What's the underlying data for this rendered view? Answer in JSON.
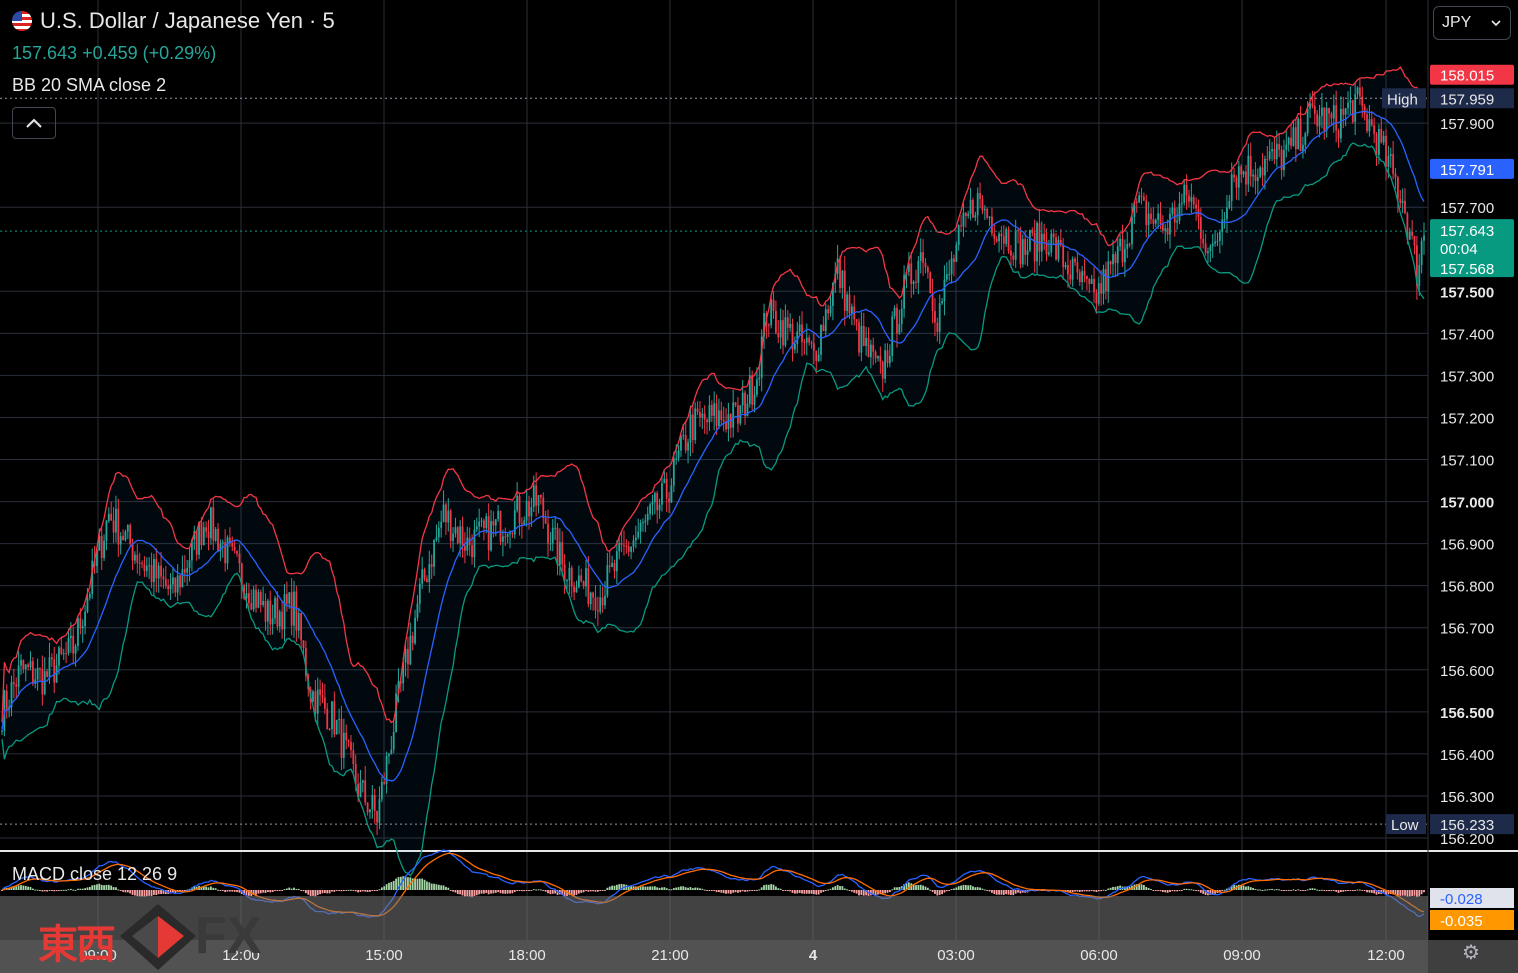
{
  "header": {
    "title": "U.S. Dollar / Japanese Yen · 5",
    "price": "157.643",
    "change": "+0.459 (+0.29%)",
    "indicator_label": "BB 20 SMA close 2",
    "collapse_icon": "chevron-up-icon"
  },
  "currency_select": {
    "value": "JPY",
    "icon": "chevron-down-icon"
  },
  "macd": {
    "label": "MACD close 12 26 9",
    "val_blue": "-0.028",
    "val_orange": "-0.035"
  },
  "watermark": {
    "text_cn": "東西",
    "text_fx": "FX"
  },
  "colors": {
    "up": "#26a69a",
    "down": "#f23645",
    "basis": "#2962ff",
    "upper": "#f23645",
    "lower": "#089981",
    "macd": "#2962ff",
    "signal": "#ff6d00"
  },
  "chart_data": {
    "type": "candlestick",
    "symbol": "USD/JPY",
    "interval": "5",
    "ylim": [
      156.2,
      158.05
    ],
    "y_ticks": [
      "157.900",
      "157.700",
      "157.500",
      "157.400",
      "157.300",
      "157.200",
      "157.100",
      "157.000",
      "156.900",
      "156.800",
      "156.700",
      "156.600",
      "156.500",
      "156.400",
      "156.300",
      "156.200"
    ],
    "x_ticks": [
      "09:00",
      "12:00",
      "15:00",
      "18:00",
      "21:00",
      "4",
      "03:00",
      "06:00",
      "09:00",
      "12:00"
    ],
    "price_labels": [
      {
        "text": "158.015",
        "value": 158.015,
        "color": "#f23645"
      },
      {
        "text": "High",
        "value": 157.959,
        "color": "#1e2a4a",
        "price": "157.959"
      },
      {
        "text": "157.791",
        "value": 157.791,
        "color": "#2962ff"
      },
      {
        "text": "157.643",
        "value": 157.643,
        "color": "#089981",
        "countdown": "00:04",
        "lower": "157.568"
      },
      {
        "text": "Low",
        "value": 156.233,
        "color": "#1e2a4a",
        "price": "156.233"
      }
    ],
    "high": 157.959,
    "low": 156.233,
    "last": 157.643,
    "waypoints": [
      [
        0,
        156.5
      ],
      [
        8,
        156.6
      ],
      [
        18,
        156.58
      ],
      [
        30,
        156.65
      ],
      [
        38,
        156.82
      ],
      [
        45,
        156.97
      ],
      [
        60,
        156.85
      ],
      [
        72,
        156.78
      ],
      [
        86,
        156.96
      ],
      [
        100,
        156.83
      ],
      [
        112,
        156.73
      ],
      [
        123,
        156.75
      ],
      [
        130,
        156.55
      ],
      [
        140,
        156.48
      ],
      [
        150,
        156.32
      ],
      [
        158,
        156.25
      ],
      [
        166,
        156.5
      ],
      [
        176,
        156.78
      ],
      [
        186,
        156.97
      ],
      [
        196,
        156.9
      ],
      [
        206,
        156.93
      ],
      [
        216,
        156.97
      ],
      [
        226,
        157.0
      ],
      [
        236,
        156.85
      ],
      [
        245,
        156.8
      ],
      [
        252,
        156.78
      ],
      [
        262,
        156.88
      ],
      [
        272,
        156.95
      ],
      [
        280,
        157.02
      ],
      [
        290,
        157.18
      ],
      [
        300,
        157.2
      ],
      [
        310,
        157.2
      ],
      [
        318,
        157.3
      ],
      [
        322,
        157.45
      ],
      [
        332,
        157.4
      ],
      [
        342,
        157.35
      ],
      [
        352,
        157.55
      ],
      [
        360,
        157.4
      ],
      [
        370,
        157.3
      ],
      [
        380,
        157.5
      ],
      [
        388,
        157.6
      ],
      [
        394,
        157.44
      ],
      [
        402,
        157.6
      ],
      [
        410,
        157.72
      ],
      [
        420,
        157.65
      ],
      [
        430,
        157.6
      ],
      [
        440,
        157.63
      ],
      [
        450,
        157.55
      ],
      [
        460,
        157.48
      ],
      [
        470,
        157.58
      ],
      [
        478,
        157.7
      ],
      [
        490,
        157.65
      ],
      [
        500,
        157.73
      ],
      [
        510,
        157.58
      ],
      [
        518,
        157.78
      ],
      [
        530,
        157.8
      ],
      [
        542,
        157.83
      ],
      [
        552,
        157.92
      ],
      [
        562,
        157.9
      ],
      [
        570,
        157.95
      ],
      [
        578,
        157.88
      ],
      [
        584,
        157.8
      ],
      [
        590,
        157.72
      ],
      [
        596,
        157.55
      ],
      [
        599,
        157.64
      ]
    ],
    "macd_series": [
      "MACD",
      "Signal",
      "Histogram"
    ]
  }
}
